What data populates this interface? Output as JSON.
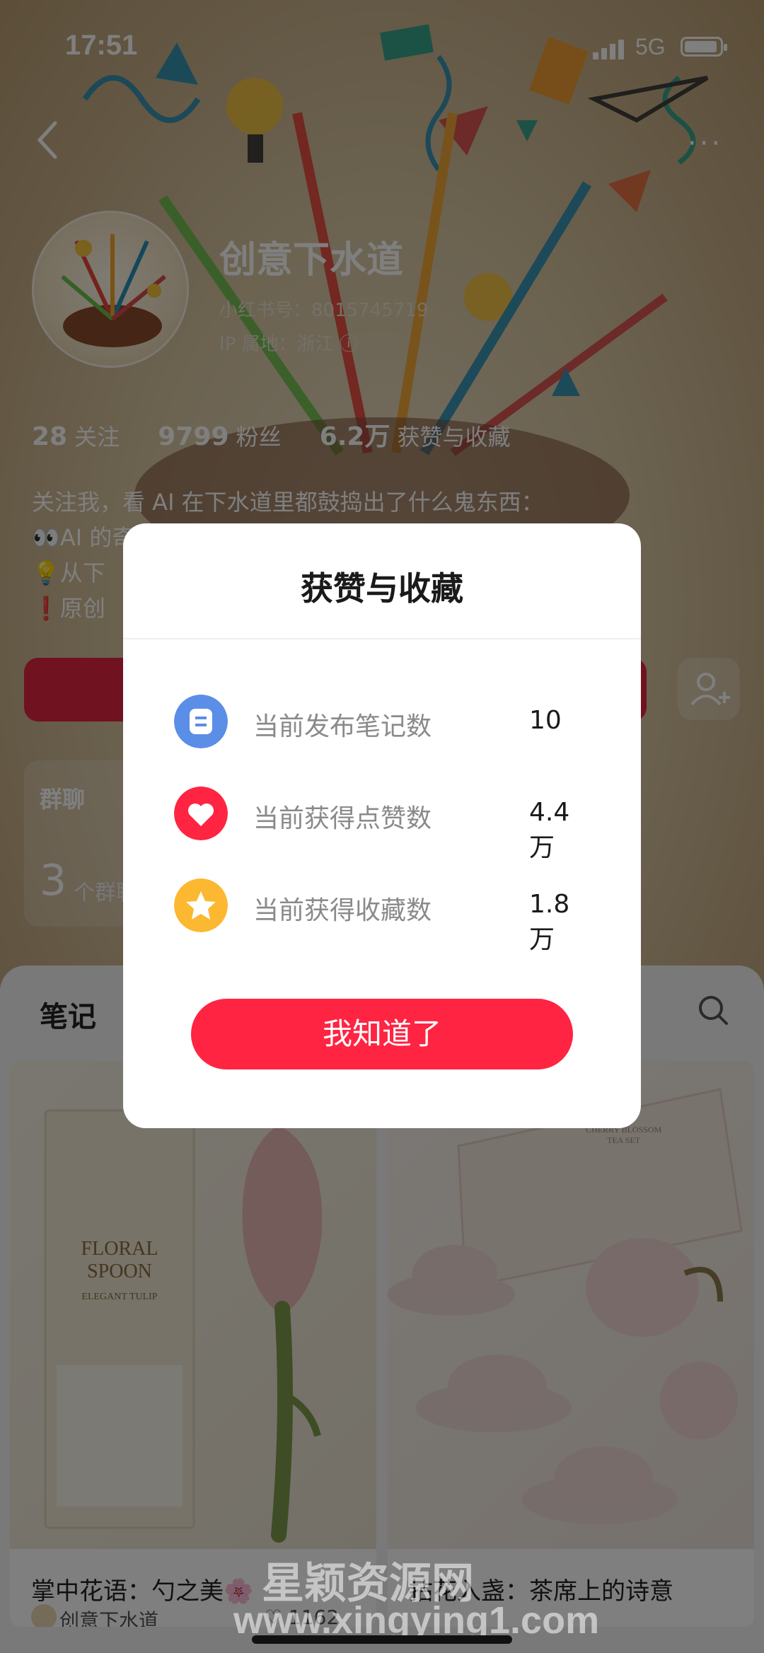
{
  "status_bar": {
    "time": "17:51",
    "network": "5G"
  },
  "profile": {
    "name": "创意下水道",
    "red_id": "小红书号：8015745719",
    "ip_location": "IP 属地：浙江",
    "stats": [
      {
        "value": "28",
        "label": "关注"
      },
      {
        "value": "9799",
        "label": "粉丝"
      },
      {
        "value": "6.2万",
        "label": "获赞与收藏"
      }
    ],
    "bio_lines": [
      "关注我，看 AI 在下水道里都鼓捣出了什么鬼东西：",
      "👀AI 的奇",
      "💡从下",
      "❗原创"
    ]
  },
  "group_chat": {
    "title": "群聊",
    "count": "3",
    "unit": "个群聊"
  },
  "notes_tab": {
    "label": "笔记"
  },
  "notes": [
    {
      "title": "掌中花语：勺之美🌸",
      "author": "创意下水道",
      "likes": "1162",
      "image_text": [
        "FLORAL",
        "SPOON",
        "ELEGANT TULIP"
      ]
    },
    {
      "title": "拈花入盏：茶席上的诗意",
      "author": "",
      "likes": "",
      "image_text": [
        "CHERRY BLOSSOM",
        "TEA SET"
      ]
    }
  ],
  "modal": {
    "title": "获赞与收藏",
    "rows": [
      {
        "icon": "note-icon",
        "label": "当前发布笔记数",
        "value": "10",
        "color": "#5b8ee6"
      },
      {
        "icon": "heart-icon",
        "label": "当前获得点赞数",
        "value": "4.4 万",
        "color": "#ff2442"
      },
      {
        "icon": "star-icon",
        "label": "当前获得收藏数",
        "value": "1.8 万",
        "color": "#fbb830"
      }
    ],
    "ok_label": "我知道了"
  },
  "watermark": {
    "line1": "星颖资源网",
    "line2": "www.xingying1.com"
  }
}
